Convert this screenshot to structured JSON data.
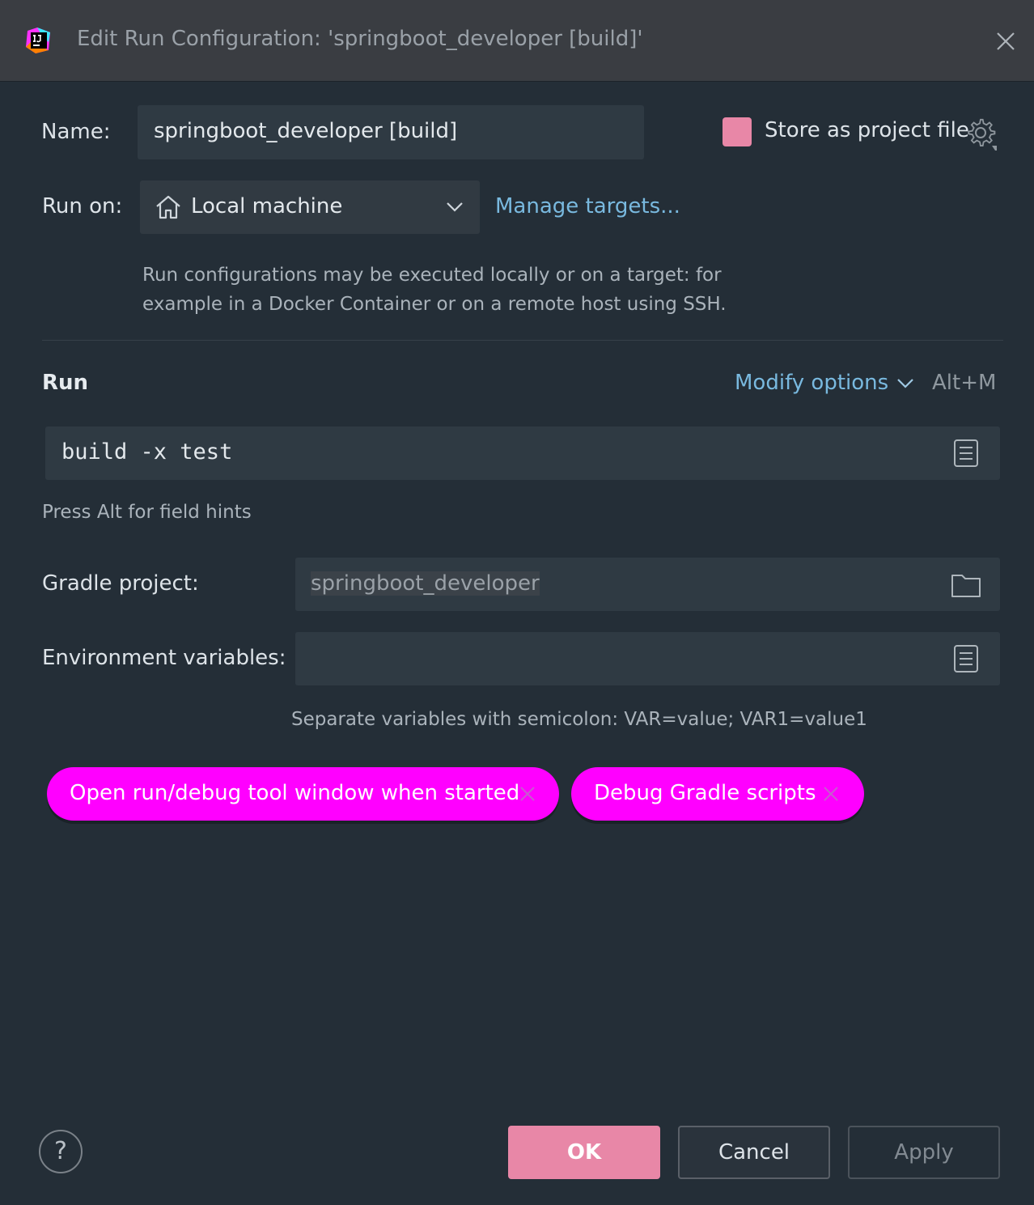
{
  "window": {
    "title": "Edit Run Configuration: 'springboot_developer [build]'",
    "app_icon": "intellij-idea-icon",
    "close_icon": "close-icon"
  },
  "name_row": {
    "label": "Name:",
    "value": "springboot_developer [build]",
    "store_label": "Store as project file",
    "store_checked": false,
    "checkbox_color": "#e887a7"
  },
  "run_on": {
    "label": "Run on:",
    "value": "Local machine",
    "manage_link": "Manage targets...",
    "hint_line1": "Run configurations may be executed locally or on a target: for",
    "hint_line2": "example in a Docker Container or on a remote host using SSH."
  },
  "run_section": {
    "title": "Run",
    "modify_options": "Modify options",
    "shortcut": "Alt+M",
    "command": "build -x test",
    "field_hint": "Press Alt for field hints"
  },
  "gradle": {
    "label": "Gradle project:",
    "value": "springboot_developer"
  },
  "env": {
    "label": "Environment variables:",
    "value": "",
    "hint": "Separate variables with semicolon: VAR=value; VAR1=value1"
  },
  "chips": [
    {
      "label": "Open run/debug tool window when started"
    },
    {
      "label": "Debug Gradle scripts"
    }
  ],
  "footer": {
    "help": "?",
    "ok": "OK",
    "cancel": "Cancel",
    "apply": "Apply"
  },
  "colors": {
    "accent": "#e887a7",
    "chip": "#ff00ff",
    "link": "#79b9df",
    "background": "#242e37",
    "titlebar": "#3a3d42"
  }
}
